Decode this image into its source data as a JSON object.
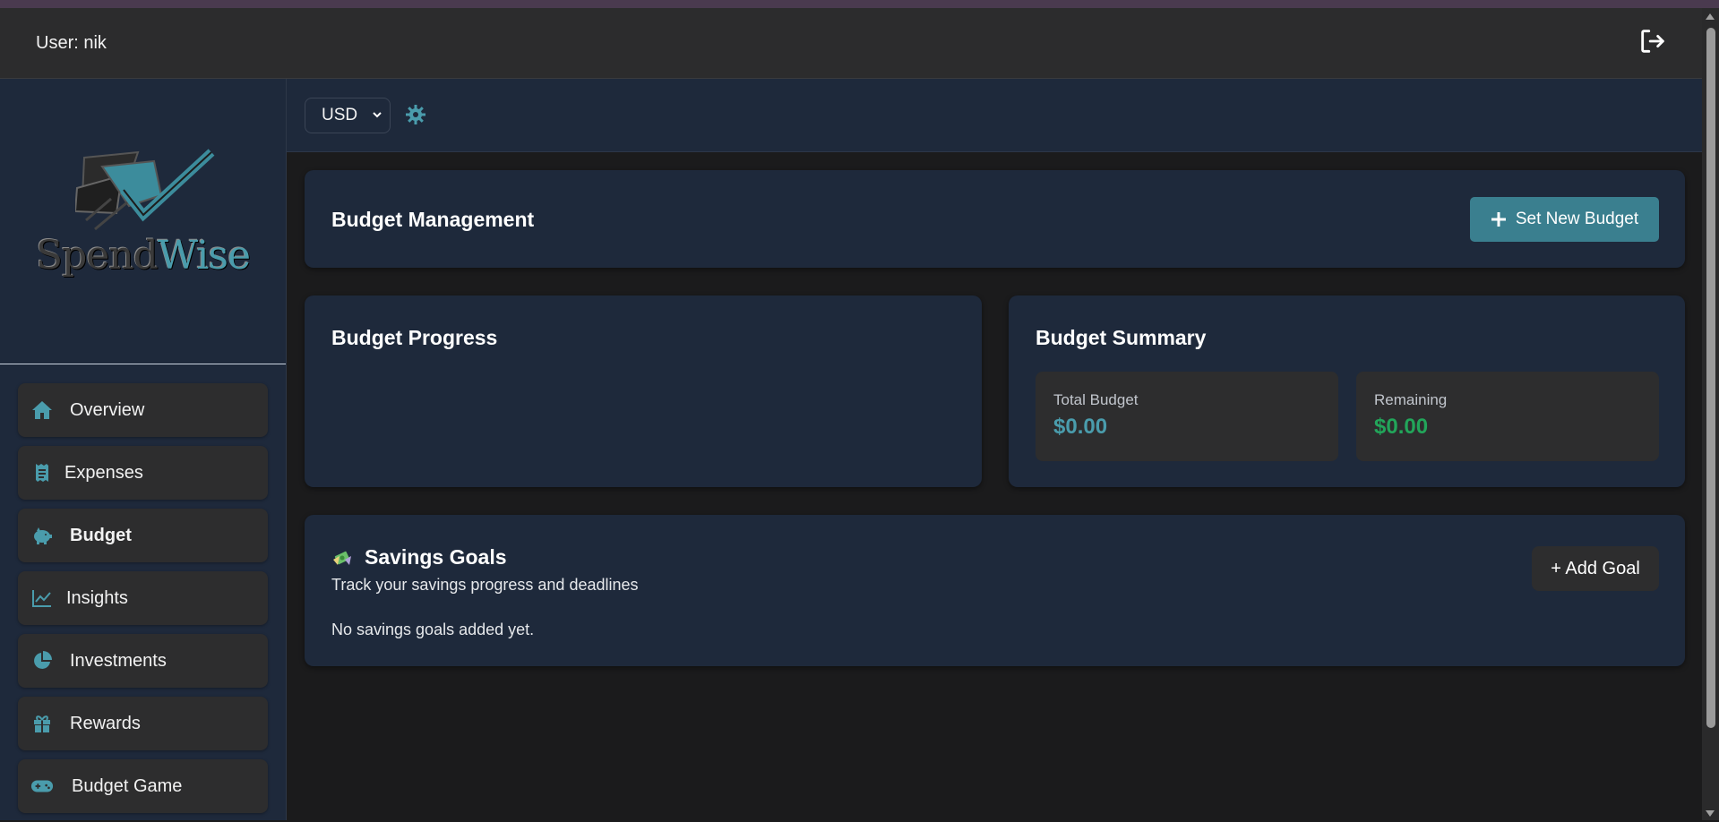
{
  "header": {
    "user_label": "User: nik"
  },
  "brand": {
    "name_part1": "Spend",
    "name_part2": "Wise"
  },
  "sidebar": {
    "items": [
      {
        "label": "Overview",
        "icon": "home-icon"
      },
      {
        "label": "Expenses",
        "icon": "receipt-icon"
      },
      {
        "label": "Budget",
        "icon": "piggy-bank-icon",
        "active": true
      },
      {
        "label": "Insights",
        "icon": "line-chart-icon"
      },
      {
        "label": "Investments",
        "icon": "pie-chart-icon"
      },
      {
        "label": "Rewards",
        "icon": "gift-icon"
      },
      {
        "label": "Budget Game",
        "icon": "gamepad-icon"
      }
    ]
  },
  "toolbar": {
    "currency": "USD"
  },
  "budget_management": {
    "title": "Budget Management",
    "set_budget_label": "Set New Budget"
  },
  "budget_progress": {
    "title": "Budget Progress"
  },
  "budget_summary": {
    "title": "Budget Summary",
    "total_label": "Total Budget",
    "total_value": "$0.00",
    "remaining_label": "Remaining",
    "remaining_value": "$0.00"
  },
  "savings_goals": {
    "title": "Savings Goals",
    "subtitle": "Track your savings progress and deadlines",
    "add_goal_label": "+ Add Goal",
    "empty_text": "No savings goals added yet."
  },
  "colors": {
    "accent": "#4a9cac",
    "primary_button": "#3a7f8f",
    "positive": "#22a55a",
    "card_bg": "#1e293b",
    "page_bg": "#1b1b1c"
  }
}
